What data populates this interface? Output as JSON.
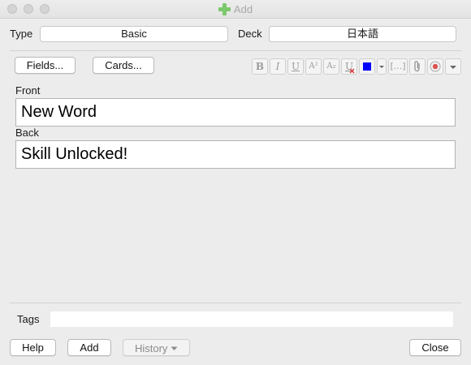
{
  "window": {
    "title": "Add",
    "icon": "green-plus-icon"
  },
  "top": {
    "type_label": "Type",
    "type_value": "Basic",
    "deck_label": "Deck",
    "deck_value": "日本語"
  },
  "toolbar": {
    "fields_label": "Fields...",
    "cards_label": "Cards...",
    "format": {
      "bold": "B",
      "italic": "I",
      "underline": "U",
      "superscript": "A²",
      "subscript": "A₂",
      "text_color": "#0000ff",
      "cloze": "[...]"
    },
    "icons": [
      "bold-icon",
      "italic-icon",
      "underline-icon",
      "superscript-icon",
      "subscript-icon",
      "clear-format-icon",
      "text-color-icon",
      "color-dropdown-icon",
      "cloze-icon",
      "attach-icon",
      "record-icon",
      "more-dropdown-icon"
    ]
  },
  "fields": [
    {
      "label": "Front",
      "value": "New Word"
    },
    {
      "label": "Back",
      "value": "Skill Unlocked!"
    }
  ],
  "tags": {
    "label": "Tags",
    "value": ""
  },
  "footer": {
    "help": "Help",
    "add": "Add",
    "history": "History",
    "close": "Close"
  }
}
